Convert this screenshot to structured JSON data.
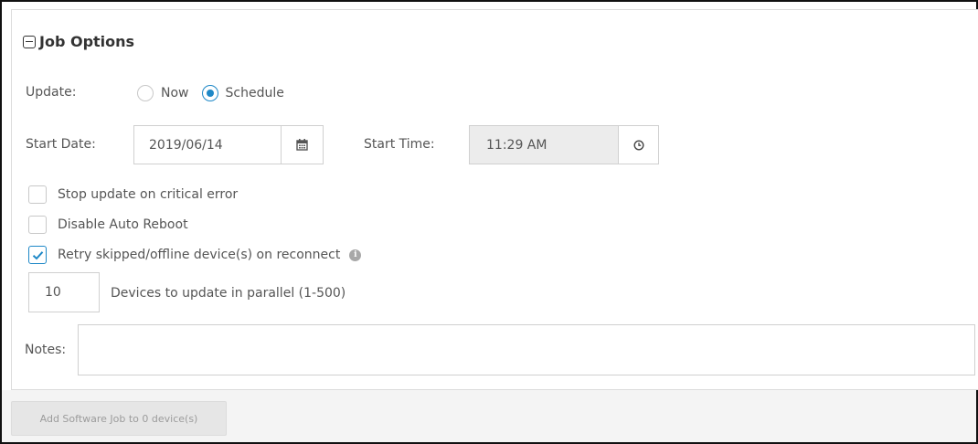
{
  "section": {
    "title": "Job Options",
    "collapse_icon": "collapse-icon"
  },
  "update": {
    "label": "Update:",
    "options": [
      "Now",
      "Schedule"
    ],
    "selected": "Schedule"
  },
  "start_date": {
    "label": "Start Date:",
    "value": "2019/06/14",
    "icon": "calendar-icon"
  },
  "start_time": {
    "label": "Start Time:",
    "value": "11:29 AM",
    "icon": "clock-icon",
    "disabled": true
  },
  "checkboxes": [
    {
      "label": "Stop update on critical error",
      "checked": false
    },
    {
      "label": "Disable Auto Reboot",
      "checked": false
    },
    {
      "label": "Retry skipped/offline device(s) on reconnect",
      "checked": true,
      "info_icon": "info-icon"
    }
  ],
  "parallel": {
    "value": "10",
    "label": "Devices to update in parallel (1-500)"
  },
  "notes": {
    "label": "Notes:",
    "value": ""
  },
  "footer": {
    "button_label": "Add Software Job to 0 device(s)",
    "button_disabled": true
  },
  "colors": {
    "accent": "#1e88c7",
    "text": "#555555",
    "disabled_bg": "#ececec"
  }
}
